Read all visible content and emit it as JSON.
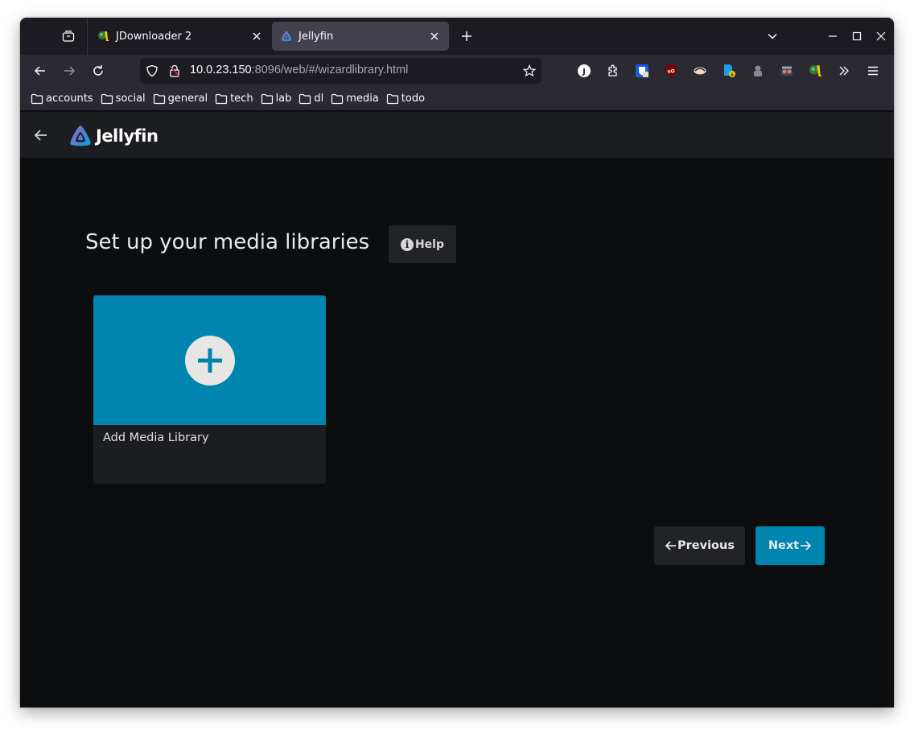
{
  "browser": {
    "tabs": [
      {
        "title": "JDownloader 2",
        "favicon": "jdownloader-icon",
        "active": false
      },
      {
        "title": "Jellyfin",
        "favicon": "jellyfin-icon",
        "active": true
      }
    ],
    "url": {
      "host": "10.0.23.150",
      "rest": ":8096/web/#/wizardlibrary.html"
    },
    "extensions": [
      "profile-j-icon",
      "extensions-puzzle-icon",
      "bitwarden-icon",
      "ublock-origin-icon",
      "tampermonkey-like-icon",
      "file-download-icon",
      "ghostery-icon",
      "privacy-badger-icon",
      "jdownloader-icon",
      "overflow-chevrons-icon",
      "menu-hamburger-icon"
    ],
    "profile_initial": "J",
    "bookmarks": [
      "accounts",
      "social",
      "general",
      "tech",
      "lab",
      "dl",
      "media",
      "todo"
    ]
  },
  "app": {
    "brand": "Jellyfin",
    "page_title": "Set up your media libraries",
    "help_label": "Help",
    "help_icon_glyph": "i",
    "card_label": "Add Media Library",
    "previous_label": "Previous",
    "next_label": "Next",
    "colors": {
      "accent": "#0085b0",
      "button_dark": "#212326",
      "background": "#0c0d0f"
    }
  }
}
